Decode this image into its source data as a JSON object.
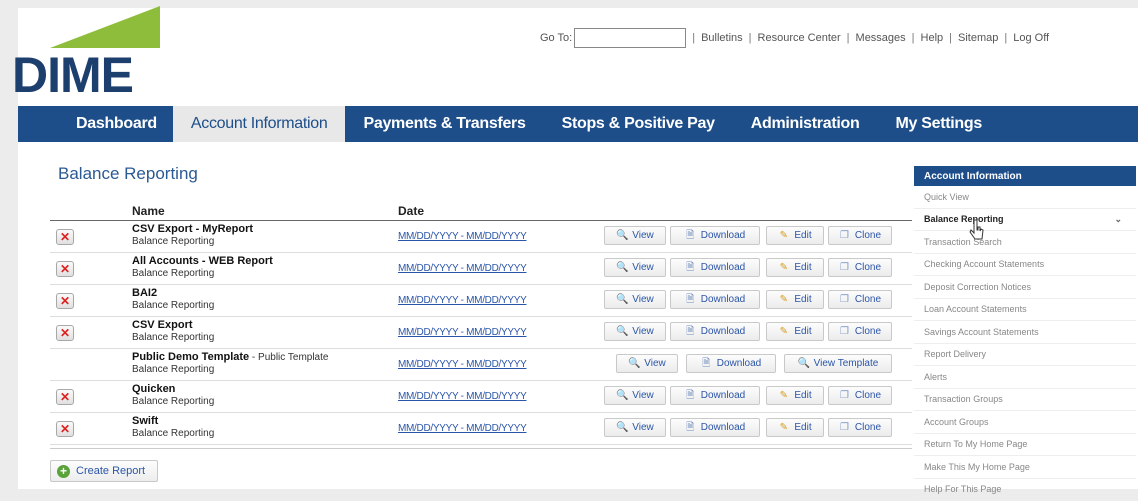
{
  "brand": {
    "logo_text": "DIME"
  },
  "topbar": {
    "goto_label": "Go To:",
    "goto_value": "",
    "links": [
      "Bulletins",
      "Resource Center",
      "Messages",
      "Help",
      "Sitemap",
      "Log Off"
    ]
  },
  "nav": {
    "tabs": [
      {
        "label": "Dashboard",
        "active": false
      },
      {
        "label": "Account Information",
        "active": true
      },
      {
        "label": "Payments & Transfers",
        "active": false
      },
      {
        "label": "Stops & Positive Pay",
        "active": false
      },
      {
        "label": "Administration",
        "active": false
      },
      {
        "label": "My Settings",
        "active": false
      }
    ]
  },
  "main": {
    "title": "Balance Reporting",
    "columns": {
      "name": "Name",
      "date": "Date"
    },
    "rows": [
      {
        "name": "CSV Export - MyReport",
        "sub": "Balance Reporting",
        "date": "MM/DD/YYYY - MM/DD/YYYY",
        "deletable": true,
        "public": false
      },
      {
        "name": "All Accounts - WEB Report",
        "sub": "Balance Reporting",
        "date": "MM/DD/YYYY - MM/DD/YYYY",
        "deletable": true,
        "public": false
      },
      {
        "name": "BAI2",
        "sub": "Balance Reporting",
        "date": "MM/DD/YYYY - MM/DD/YYYY",
        "deletable": true,
        "public": false
      },
      {
        "name": "CSV Export",
        "sub": "Balance Reporting",
        "date": "MM/DD/YYYY - MM/DD/YYYY",
        "deletable": true,
        "public": false
      },
      {
        "name": "Public Demo Template",
        "name_suffix": " - Public Template",
        "sub": "Balance Reporting",
        "date": "MM/DD/YYYY - MM/DD/YYYY",
        "deletable": false,
        "public": true
      },
      {
        "name": "Quicken",
        "sub": "Balance Reporting",
        "date": "MM/DD/YYYY - MM/DD/YYYY",
        "deletable": true,
        "public": false
      },
      {
        "name": "Swift",
        "sub": "Balance Reporting",
        "date": "MM/DD/YYYY - MM/DD/YYYY",
        "deletable": true,
        "public": false
      }
    ],
    "buttons": {
      "view": "View",
      "download": "Download",
      "edit": "Edit",
      "clone": "Clone",
      "view_template": "View Template"
    },
    "create_label": "Create Report"
  },
  "sidebar": {
    "heading": "Account Information",
    "items": [
      {
        "label": "Quick View",
        "active": false
      },
      {
        "label": "Balance Reporting",
        "active": true
      },
      {
        "label": "Transaction Search",
        "active": false
      },
      {
        "label": "Checking Account Statements",
        "active": false
      },
      {
        "label": "Deposit Correction Notices",
        "active": false
      },
      {
        "label": "Loan Account Statements",
        "active": false
      },
      {
        "label": "Savings Account Statements",
        "active": false
      },
      {
        "label": "Report Delivery",
        "active": false
      },
      {
        "label": "Alerts",
        "active": false
      },
      {
        "label": "Transaction Groups",
        "active": false
      },
      {
        "label": "Account Groups",
        "active": false
      },
      {
        "label": "Return To My Home Page",
        "active": false
      },
      {
        "label": "Make This My Home Page",
        "active": false
      },
      {
        "label": "Help For This Page",
        "active": false
      }
    ]
  },
  "colors": {
    "navy": "#1d4e8a",
    "green": "#8dbd3b",
    "link": "#2a55a8"
  }
}
